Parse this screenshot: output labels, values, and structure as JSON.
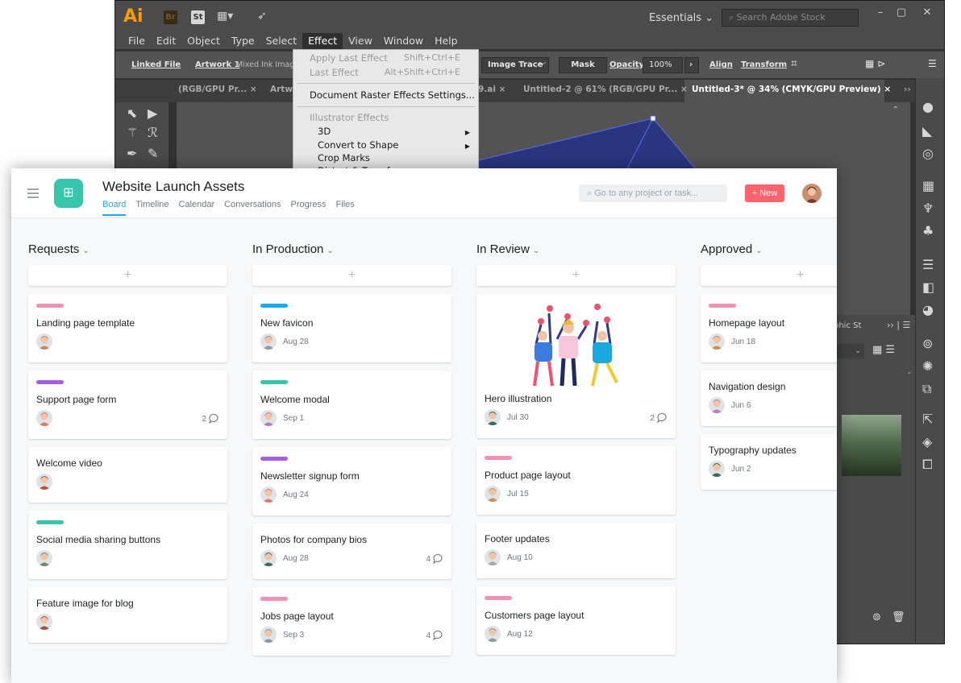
{
  "illustrator": {
    "logo": "Ai",
    "bridge_badge": "Br",
    "stock_badge": "St",
    "workspace": "Essentials",
    "search_placeholder": "Search Adobe Stock",
    "menu": [
      "File",
      "Edit",
      "Object",
      "Type",
      "Select",
      "Effect",
      "View",
      "Window",
      "Help"
    ],
    "control_bar": {
      "linked_file": "Linked File",
      "artwork": "Artwork 1",
      "mixed_ink": "Mixed Ink Imag",
      "image_trace": "Image Trace",
      "mask": "Mask",
      "opacity_label": "Opacity:",
      "opacity_value": "100%",
      "align": "Align",
      "transform": "Transform"
    },
    "tabs": [
      "(RGB/GPU Pr... ×",
      "Artw",
      "9.ai ×",
      "Untitled-2 @ 61% (RGB/GPU Pr... ×",
      "Untitled-3* @ 34% (CMYK/GPU Preview) ×"
    ],
    "panel_label": "phic St",
    "effect_menu": {
      "apply_last": "Apply Last Effect",
      "apply_last_shortcut": "Shift+Ctrl+E",
      "last_effect": "Last Effect",
      "last_effect_shortcut": "Alt+Shift+Ctrl+E",
      "raster_settings": "Document Raster Effects Settings...",
      "section": "Illustrator Effects",
      "items": [
        "3D",
        "Convert to Shape",
        "Crop Marks",
        "Distort & Transform"
      ]
    }
  },
  "asana": {
    "project_title": "Website Launch Assets",
    "nav": [
      "Board",
      "Timeline",
      "Calendar",
      "Conversations",
      "Progress",
      "Files"
    ],
    "search_placeholder": "Go to any project or task...",
    "new_button": "+ New",
    "colors": {
      "pink": "#f78fb3",
      "purple": "#a55ee3",
      "teal": "#37c5ab",
      "blue": "#14aaf5",
      "accent": "#fc636b"
    },
    "columns": [
      {
        "title": "Requests",
        "cards": [
          {
            "title": "Landing page template",
            "tag": "#f78fb3",
            "avatar": "#c9876b",
            "due": "",
            "comments": ""
          },
          {
            "title": "Support page form",
            "tag": "#a55ee3",
            "avatar": "#e07a6a",
            "due": "",
            "comments": "2"
          },
          {
            "title": "Welcome video",
            "tag": "",
            "avatar": "#b8553f",
            "due": "",
            "comments": ""
          },
          {
            "title": "Social media sharing buttons",
            "tag": "#37c5ab",
            "avatar": "#6f8a6a",
            "due": "",
            "comments": ""
          },
          {
            "title": "Feature image for blog",
            "tag": "",
            "avatar": "#a8553f",
            "due": "",
            "comments": ""
          }
        ]
      },
      {
        "title": "In Production",
        "cards": [
          {
            "title": "New favicon",
            "tag": "#14aaf5",
            "avatar": "#8d9aa3",
            "due": "Aug 28",
            "comments": ""
          },
          {
            "title": "Welcome modal",
            "tag": "#37c5ab",
            "avatar": "#b47fc2",
            "due": "Sep 1",
            "comments": ""
          },
          {
            "title": "Newsletter signup form",
            "tag": "#a55ee3",
            "avatar": "#e07a6a",
            "due": "Aug 24",
            "comments": ""
          },
          {
            "title": "Photos for company bios",
            "tag": "",
            "avatar": "#3b6b5c",
            "due": "Aug 28",
            "comments": "4"
          },
          {
            "title": "Jobs page layout",
            "tag": "#f78fb3",
            "avatar": "#8d9aa3",
            "due": "Sep 3",
            "comments": "4"
          }
        ]
      },
      {
        "title": "In Review",
        "cards": [
          {
            "title": "Hero illustration",
            "tag": "",
            "avatar": "#3b6b5c",
            "due": "Jul 30",
            "comments": "2",
            "image": true
          },
          {
            "title": "Product page layout",
            "tag": "#f78fb3",
            "avatar": "#c98f4f",
            "due": "Jul 15",
            "comments": ""
          },
          {
            "title": "Footer updates",
            "tag": "",
            "avatar": "#a0a8a0",
            "due": "Aug 10",
            "comments": ""
          },
          {
            "title": "Customers page layout",
            "tag": "#f78fb3",
            "avatar": "#8d9aa3",
            "due": "Aug 12",
            "comments": ""
          }
        ]
      },
      {
        "title": "Approved",
        "cards": [
          {
            "title": "Homepage layout",
            "tag": "#f78fb3",
            "avatar": "#c98f4f",
            "due": "Jun 18",
            "comments": ""
          },
          {
            "title": "Navigation design",
            "tag": "",
            "avatar": "#b47fc2",
            "due": "Jun 6",
            "comments": ""
          },
          {
            "title": "Typography updates",
            "tag": "",
            "avatar": "#3b6b5c",
            "due": "Jun 2",
            "comments": ""
          }
        ]
      }
    ]
  }
}
